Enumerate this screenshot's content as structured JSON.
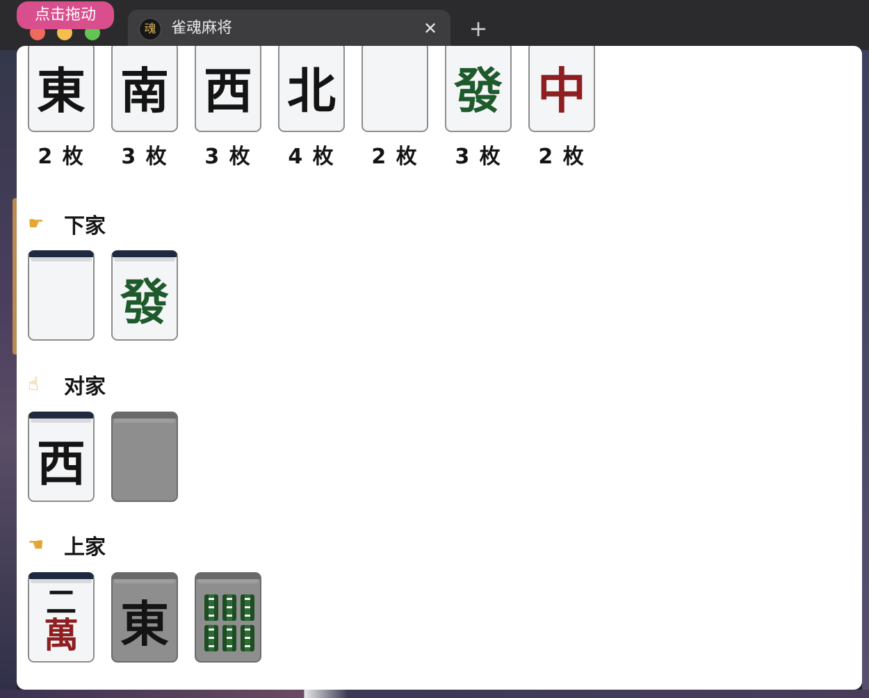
{
  "window": {
    "drag_badge": "点击拖动",
    "tab_title": "雀魂麻将",
    "tab_favicon_glyph": "魂",
    "tab_close_glyph": "✕",
    "new_tab_glyph": "+"
  },
  "remaining": {
    "tiles": [
      {
        "glyph": "東",
        "color": "#141414",
        "count": "2 枚"
      },
      {
        "glyph": "南",
        "color": "#141414",
        "count": "3 枚"
      },
      {
        "glyph": "西",
        "color": "#141414",
        "count": "3 枚"
      },
      {
        "glyph": "北",
        "color": "#141414",
        "count": "4 枚"
      },
      {
        "glyph": "",
        "color": "#141414",
        "count": "2 枚"
      },
      {
        "glyph": "發",
        "color": "#1f5a2c",
        "count": "3 枚"
      },
      {
        "glyph": "中",
        "color": "#8e1e20",
        "count": "2 枚"
      }
    ]
  },
  "sections": {
    "shimocha": {
      "hand_icon": "☛",
      "label": "下家"
    },
    "toimen": {
      "hand_icon": "☝",
      "label": "对家"
    },
    "kamicha": {
      "hand_icon": "☚",
      "label": "上家"
    }
  },
  "discards": {
    "shimocha": [
      {
        "glyph": "",
        "dimmed": false
      },
      {
        "glyph": "發",
        "dimmed": false
      }
    ],
    "toimen": [
      {
        "glyph": "西",
        "dimmed": false
      },
      {
        "glyph": "",
        "dimmed": true
      }
    ],
    "kamicha": [
      {
        "num": "二",
        "suit": "萬",
        "dimmed": false
      },
      {
        "glyph": "東",
        "dimmed": true
      },
      {
        "tile": "6 sou",
        "dimmed": true
      }
    ]
  }
}
